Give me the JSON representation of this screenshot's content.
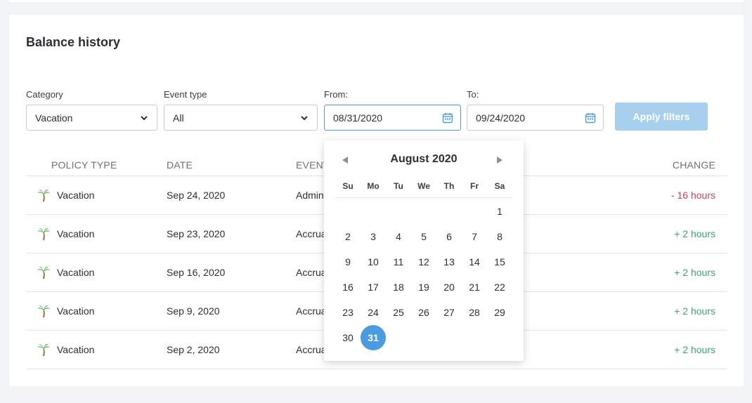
{
  "card": {
    "title": "Balance history"
  },
  "filters": {
    "category": {
      "label": "Category",
      "value": "Vacation"
    },
    "event_type": {
      "label": "Event type",
      "value": "All"
    },
    "from": {
      "label": "From:",
      "value": "08/31/2020"
    },
    "to": {
      "label": "To:",
      "value": "09/24/2020"
    },
    "apply_label": "Apply filters"
  },
  "table": {
    "headers": [
      "POLICY TYPE",
      "DATE",
      "EVENT",
      "CHANGE"
    ],
    "rows": [
      {
        "policy": "Vacation",
        "date": "Sep 24, 2020",
        "event": "Admin",
        "change": "- 16 hours"
      },
      {
        "policy": "Vacation",
        "date": "Sep 23, 2020",
        "event": "Accrual",
        "change": "+ 2 hours"
      },
      {
        "policy": "Vacation",
        "date": "Sep 16, 2020",
        "event": "Accrual",
        "change": "+ 2 hours"
      },
      {
        "policy": "Vacation",
        "date": "Sep 9, 2020",
        "event": "Accrual",
        "change": "+ 2 hours"
      },
      {
        "policy": "Vacation",
        "date": "Sep 2, 2020",
        "event": "Accrual",
        "change": "+ 2 hours"
      }
    ]
  },
  "datepicker": {
    "month_label": "August 2020",
    "weekdays": [
      "Su",
      "Mo",
      "Tu",
      "We",
      "Th",
      "Fr",
      "Sa"
    ],
    "days": [
      "1",
      "2",
      "3",
      "4",
      "5",
      "6",
      "7",
      "8",
      "9",
      "10",
      "11",
      "12",
      "13",
      "14",
      "15",
      "16",
      "17",
      "18",
      "19",
      "20",
      "21",
      "22",
      "23",
      "24",
      "25",
      "26",
      "27",
      "28",
      "29",
      "30",
      "31"
    ],
    "first_weekday": 6,
    "selected": "31"
  },
  "colors": {
    "accent": "#4a9be0",
    "apply_disabled": "#a7d0ef",
    "negative": "#c2455a",
    "positive": "#3aa76d"
  },
  "icons": {
    "dropdown": "chevron-down-icon",
    "date": "calendar-icon",
    "policy": "palm-tree-icon",
    "prev": "triangle-left-icon",
    "next": "triangle-right-icon"
  }
}
